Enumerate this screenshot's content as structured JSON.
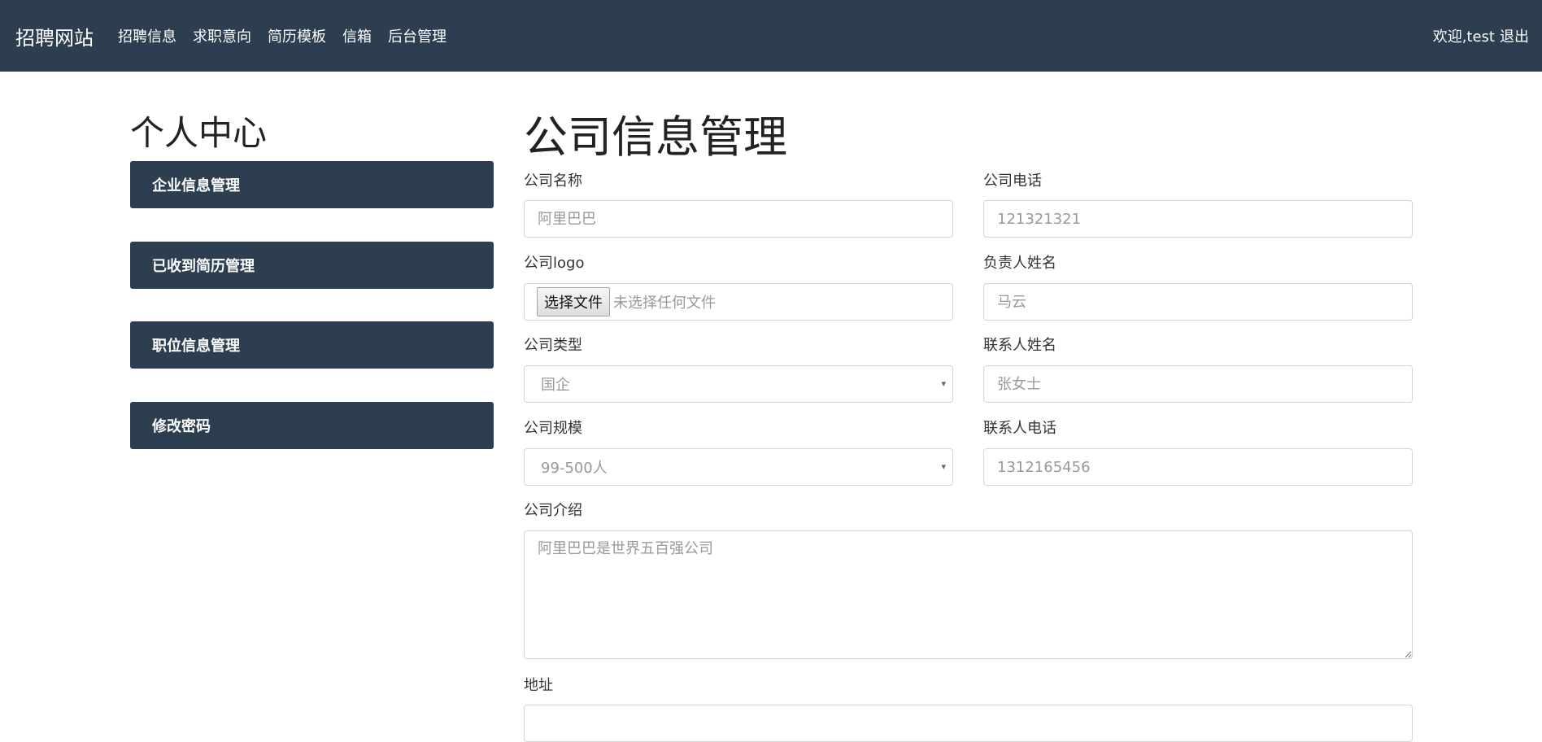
{
  "navbar": {
    "brand": "招聘网站",
    "links": [
      "招聘信息",
      "求职意向",
      "简历模板",
      "信箱",
      "后台管理"
    ],
    "welcome": "欢迎,test",
    "logout": "退出"
  },
  "sidebar": {
    "title": "个人中心",
    "items": [
      "企业信息管理",
      "已收到简历管理",
      "职位信息管理",
      "修改密码"
    ]
  },
  "form": {
    "title": "公司信息管理",
    "company_name": {
      "label": "公司名称",
      "placeholder": "阿里巴巴"
    },
    "company_phone": {
      "label": "公司电话",
      "placeholder": "121321321"
    },
    "company_logo": {
      "label": "公司logo",
      "button": "选择文件",
      "status": "未选择任何文件"
    },
    "manager_name": {
      "label": "负责人姓名",
      "placeholder": "马云"
    },
    "company_type": {
      "label": "公司类型",
      "value": "国企"
    },
    "contact_name": {
      "label": "联系人姓名",
      "placeholder": "张女士"
    },
    "company_size": {
      "label": "公司规模",
      "value": "99-500人"
    },
    "contact_phone": {
      "label": "联系人电话",
      "placeholder": "1312165456"
    },
    "company_intro": {
      "label": "公司介绍",
      "placeholder": "阿里巴巴是世界五百强公司"
    },
    "address": {
      "label": "地址"
    }
  },
  "colors": {
    "navbar_bg": "#2c3e50",
    "sidebar_item_bg": "#2c3e50",
    "input_border": "#cfd6dd",
    "placeholder_text": "#999999"
  },
  "icons": {
    "select_caret": "chevron-down-icon",
    "textarea_resize": "resize-grip-icon"
  }
}
